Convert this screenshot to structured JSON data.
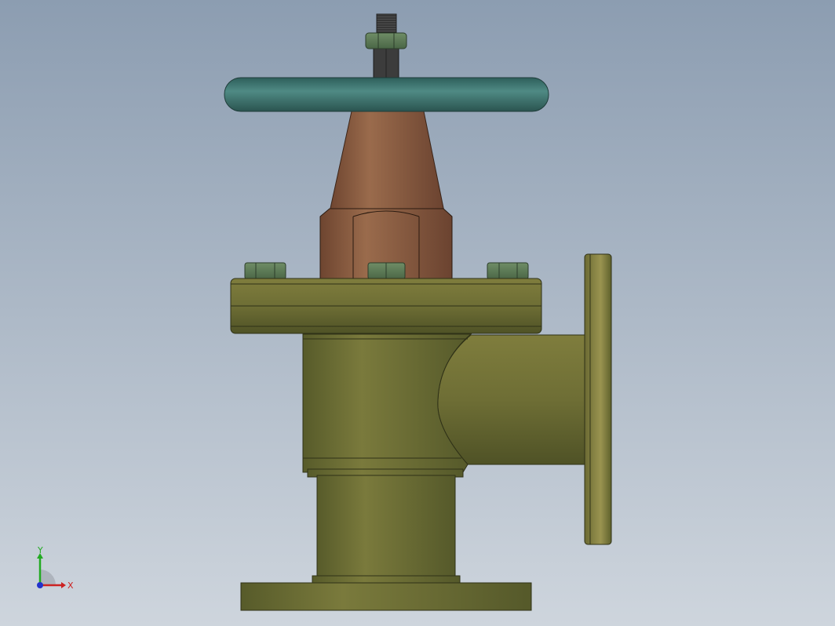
{
  "viewport": {
    "background_top": "#8c9db1",
    "background_bottom": "#ced5dd"
  },
  "model": {
    "handwheel_color": "#3f7470",
    "bonnet_color": "#7f5238",
    "body_color": "#6d6d35",
    "nut_color": "#5d7a55",
    "stem_color": "#3a3a3a"
  },
  "triad": {
    "x_label": "X",
    "y_label": "Y",
    "x_color": "#cc2222",
    "y_color": "#22aa22",
    "z_color": "#2233cc"
  }
}
